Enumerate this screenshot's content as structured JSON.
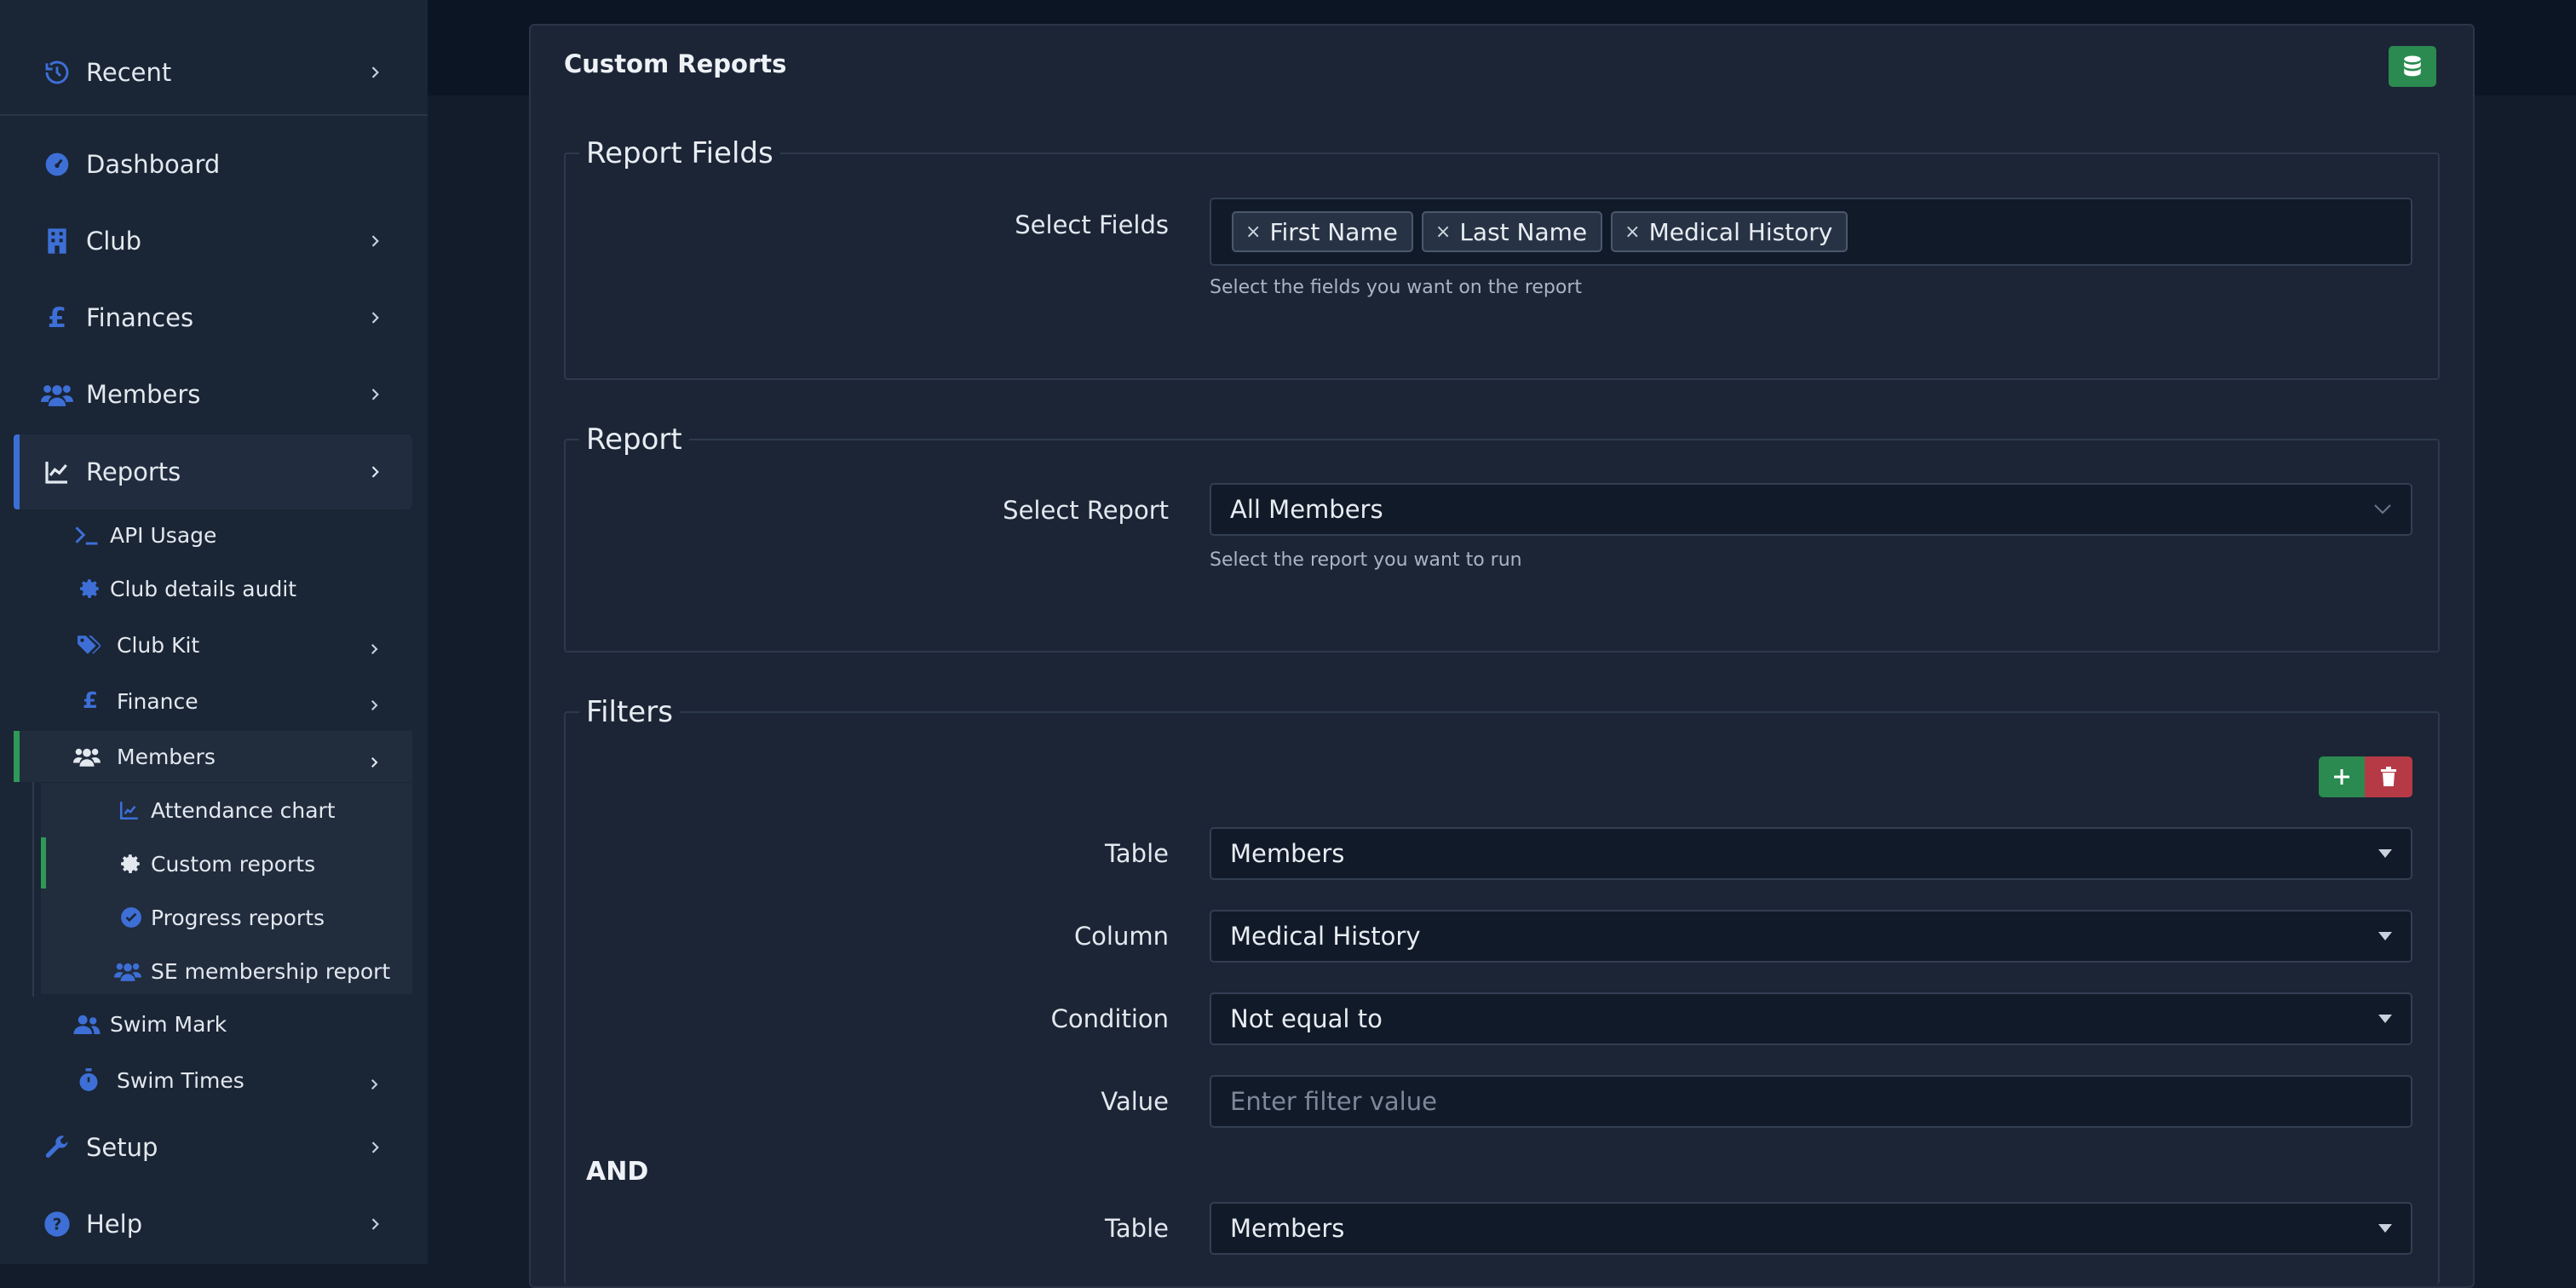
{
  "sidebar": {
    "recent": "Recent",
    "dashboard": "Dashboard",
    "club": "Club",
    "finances": "Finances",
    "members": "Members",
    "reports": "Reports",
    "reports_sub": {
      "api_usage": "API Usage",
      "club_details_audit": "Club details audit",
      "club_kit": "Club Kit",
      "finance": "Finance",
      "members": "Members",
      "members_sub": {
        "attendance_chart": "Attendance chart",
        "custom_reports": "Custom reports",
        "progress_reports": "Progress reports",
        "se_membership_report": "SE membership report"
      },
      "swim_mark": "Swim Mark",
      "swim_times": "Swim Times"
    },
    "setup": "Setup",
    "help": "Help"
  },
  "card": {
    "title": "Custom Reports"
  },
  "report_fields": {
    "legend": "Report Fields",
    "label": "Select Fields",
    "tags": [
      "First Name",
      "Last Name",
      "Medical History"
    ],
    "help": "Select the fields you want on the report"
  },
  "report": {
    "legend": "Report",
    "label": "Select Report",
    "value": "All Members",
    "help": "Select the report you want to run"
  },
  "filters": {
    "legend": "Filters",
    "table_label": "Table",
    "table_value": "Members",
    "column_label": "Column",
    "column_value": "Medical History",
    "condition_label": "Condition",
    "condition_value": "Not equal to",
    "value_label": "Value",
    "value_placeholder": "Enter filter value",
    "and_label": "AND",
    "table2_label": "Table",
    "table2_value": "Members"
  },
  "colors": {
    "accent_blue": "#3b6fd4",
    "success_green": "#2a8a4f",
    "danger_red": "#b63a46"
  }
}
